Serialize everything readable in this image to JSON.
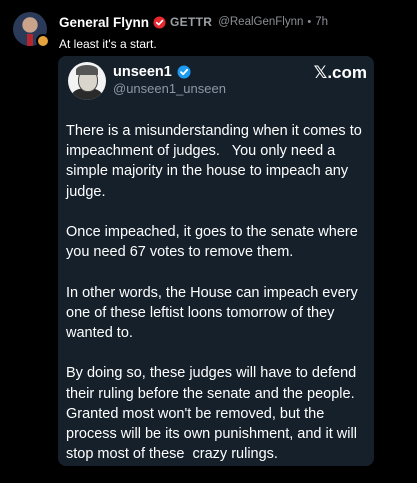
{
  "post": {
    "display_name": "General Flynn",
    "platform_name": "GETTR",
    "handle": "@RealGenFlynn",
    "separator": "•",
    "time": "7h",
    "text": "At least it's a start."
  },
  "card": {
    "name": "unseen1",
    "handle": "@unseen1_unseen",
    "logo": "𝕏.com",
    "paragraphs": [
      "There is a misunderstanding when it comes to\nimpeachment of judges.   You only need a\nsimple majority in the house to impeach any\njudge.",
      "Once impeached, it goes to the senate where\nyou need 67 votes to remove them.",
      "In other words, the House can impeach every\none of these leftist loons tomorrow of they\nwanted to.",
      "By doing so, these judges will have to defend\ntheir ruling before the senate and the people.\nGranted most won't be removed, but the\nprocess will be its own punishment, and it will\nstop most of these  crazy rulings."
    ]
  },
  "icons": {
    "avatar_badge": "award-badge-icon",
    "gettr_badge": "gettr-verified-icon",
    "card_verified": "verified-check-icon"
  },
  "colors": {
    "background": "#000000",
    "card_background": "#15202b",
    "gettr_red": "#e8262d",
    "verified_blue": "#1d9bf0"
  }
}
